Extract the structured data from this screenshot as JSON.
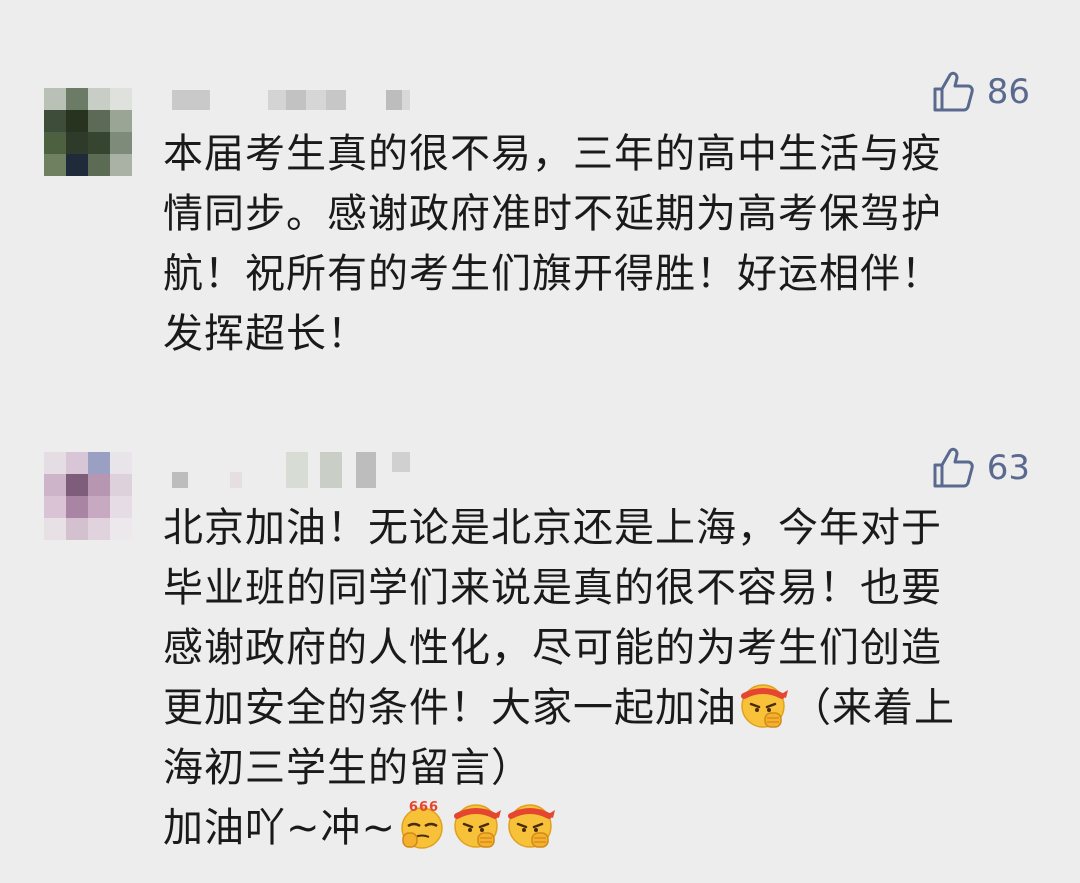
{
  "comments": [
    {
      "likes": "86",
      "lines": [
        "本届考生真的很不易，三年的高中生活与疫",
        "情同步。感谢政府准时不延期为高考保驾护",
        "航！祝所有的考生们旗开得胜！好运相伴！",
        "发挥超长！"
      ]
    },
    {
      "likes": "63",
      "lines": [
        "北京加油！无论是北京还是上海，今年对于",
        "毕业班的同学们来说是真的很不容易！也要",
        "感谢政府的人性化，尽可能的为考生们创造"
      ],
      "line4_before": "更加安全的条件！大家一起加油",
      "line4_after": "（来着上",
      "line5": "海初三学生的留言）",
      "line6": "加油吖~冲~",
      "emoji_666_text": "666"
    }
  ],
  "colors": {
    "background": "#ededed",
    "text": "#1a1a1a",
    "like": "#5a6a8e"
  },
  "icons": [
    "thumbs-up-icon",
    "fist-emoji",
    "666-emoji"
  ]
}
